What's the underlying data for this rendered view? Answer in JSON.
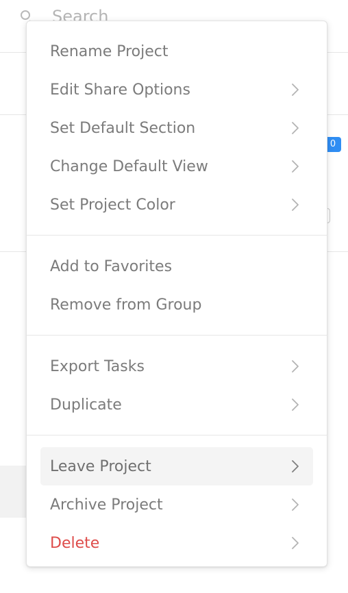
{
  "search": {
    "placeholder": "Search"
  },
  "background": {
    "badge_text": "0"
  },
  "menu": {
    "groups": [
      {
        "items": [
          {
            "label": "Rename Project",
            "submenu": false
          },
          {
            "label": "Edit Share Options",
            "submenu": true
          },
          {
            "label": "Set Default Section",
            "submenu": true
          },
          {
            "label": "Change Default View",
            "submenu": true
          },
          {
            "label": "Set Project Color",
            "submenu": true
          }
        ]
      },
      {
        "items": [
          {
            "label": "Add to Favorites",
            "submenu": false
          },
          {
            "label": "Remove from Group",
            "submenu": false
          }
        ]
      },
      {
        "items": [
          {
            "label": "Export Tasks",
            "submenu": true
          },
          {
            "label": "Duplicate",
            "submenu": true
          }
        ]
      },
      {
        "items": [
          {
            "label": "Leave Project",
            "submenu": true,
            "highlighted": true
          },
          {
            "label": "Archive Project",
            "submenu": true
          },
          {
            "label": "Delete",
            "submenu": true,
            "danger": true
          }
        ]
      }
    ]
  },
  "colors": {
    "text": "#7b7b7b",
    "danger": "#de4c4a",
    "hover_bg": "#f4f4f4",
    "divider": "#e6e6e6",
    "accent": "#2f8df3"
  },
  "icons": {
    "search": "search-icon",
    "submenu": "chevron-right-icon"
  }
}
